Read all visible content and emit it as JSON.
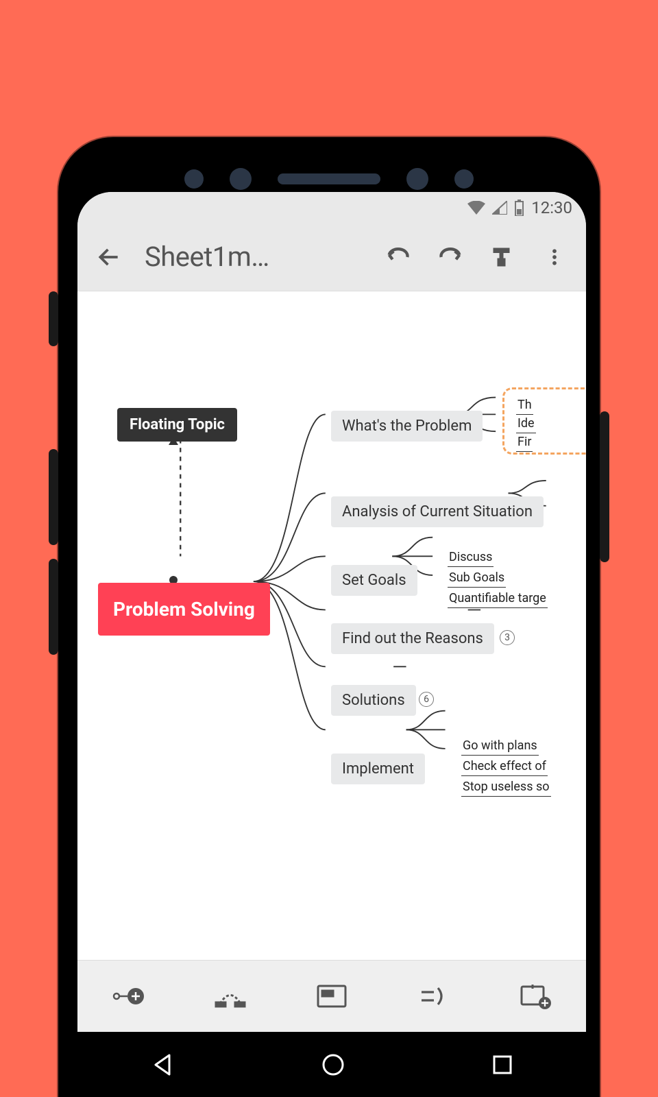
{
  "status": {
    "time": "12:30"
  },
  "toolbar": {
    "back": "back",
    "title": "Sheet1m…",
    "undo": "undo",
    "redo": "redo",
    "format": "format",
    "more": "more"
  },
  "mindmap": {
    "floating": "Floating Topic",
    "central": "Problem Solving",
    "branches": [
      {
        "label": "What's the Problem",
        "leaves": [
          "Th",
          "Ide",
          "Fir"
        ]
      },
      {
        "label": "Analysis of Current Situation"
      },
      {
        "label": "Set Goals",
        "leaves": [
          "Discuss",
          "Sub Goals",
          "Quantifiable targe"
        ]
      },
      {
        "label": "Find out the Reasons",
        "count": "3"
      },
      {
        "label": "Solutions",
        "count": "6"
      },
      {
        "label": "Implement",
        "leaves": [
          "Go with plans",
          "Check effect of",
          "Stop useless so"
        ]
      }
    ]
  },
  "bottombar": {
    "btn1": "add-subtopic",
    "btn2": "add-relationship",
    "btn3": "add-boundary",
    "btn4": "add-summary",
    "btn5": "add-sheet"
  }
}
